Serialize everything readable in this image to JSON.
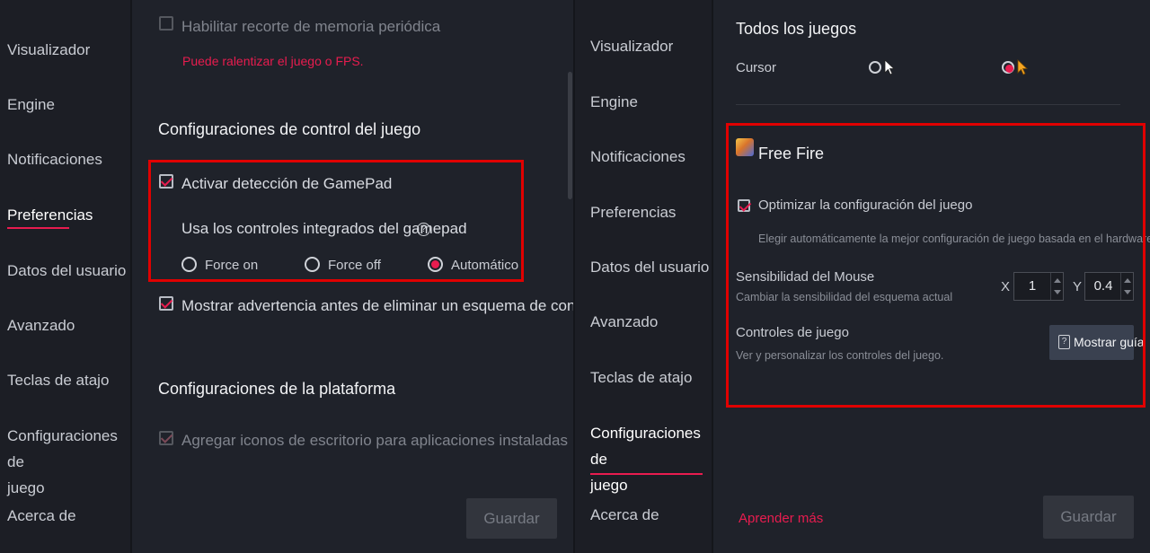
{
  "left": {
    "sidebar": {
      "items": [
        {
          "label": "Visualizador"
        },
        {
          "label": "Engine"
        },
        {
          "label": "Notificaciones"
        },
        {
          "label": "Preferencias"
        },
        {
          "label": "Datos del usuario"
        },
        {
          "label": "Avanzado"
        },
        {
          "label": "Teclas de atajo"
        },
        {
          "label_line1": "Configuraciones de",
          "label_line2": "juego"
        },
        {
          "label": "Acerca de"
        }
      ]
    },
    "content": {
      "memory_trim_label": "Habilitar recorte de memoria periódica",
      "memory_trim_warning": "Puede ralentizar el juego o FPS.",
      "game_controls_heading": "Configuraciones de control del juego",
      "gamepad_detection_label": "Activar detección de GamePad",
      "gamepad_controls_label": "Usa los controles integrados del gamepad",
      "help_glyph": "?",
      "radio_options": [
        {
          "label": "Force on",
          "selected": false
        },
        {
          "label": "Force off",
          "selected": false
        },
        {
          "label": "Automático",
          "selected": true
        }
      ],
      "delete_warning_label": "Mostrar advertencia antes de eliminar un esquema de control",
      "platform_heading": "Configuraciones de la plataforma",
      "desktop_icons_label": "Agregar iconos de escritorio para aplicaciones instaladas",
      "save_button": "Guardar"
    }
  },
  "right": {
    "sidebar": {
      "items": [
        {
          "label": "Visualizador"
        },
        {
          "label": "Engine"
        },
        {
          "label": "Notificaciones"
        },
        {
          "label": "Preferencias"
        },
        {
          "label": "Datos del usuario"
        },
        {
          "label": "Avanzado"
        },
        {
          "label": "Teclas de atajo"
        },
        {
          "label_line1": "Configuraciones de",
          "label_line2": "juego"
        },
        {
          "label": "Acerca de"
        }
      ]
    },
    "content": {
      "all_games_heading": "Todos los juegos",
      "cursor_label": "Cursor",
      "game_name": "Free Fire",
      "optimize_label": "Optimizar la configuración del juego",
      "optimize_desc": "Elegir automáticamente la mejor configuración de juego basada en el hardware de mi PC",
      "mouse_sensitivity_label": "Sensibilidad del Mouse",
      "mouse_sensitivity_desc": "Cambiar la sensibilidad del esquema actual",
      "x_label": "X",
      "x_value": "1",
      "y_label": "Y",
      "y_value": "0.4",
      "game_controls_label": "Controles de juego",
      "game_controls_desc": "Ver y personalizar los controles del juego.",
      "show_guide_glyph": "?",
      "show_guide_button": "Mostrar guía",
      "learn_more": "Aprender más",
      "save_button": "Guardar"
    }
  },
  "colors": {
    "accent": "#e81c4f",
    "highlight_box": "#e00000"
  }
}
